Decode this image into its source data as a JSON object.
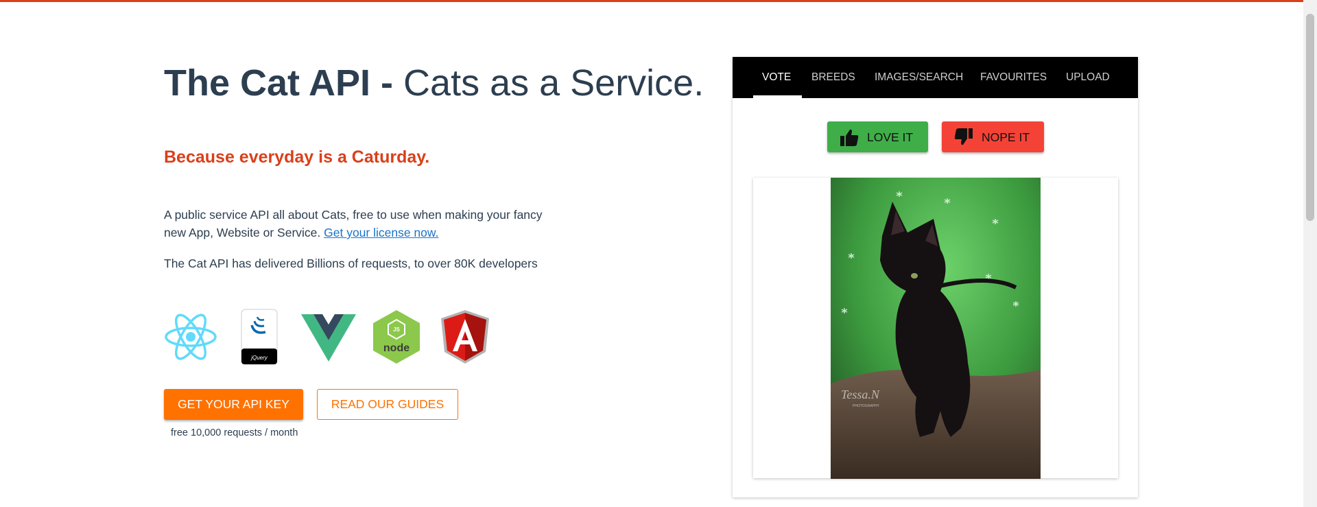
{
  "hero": {
    "title_bold": "The Cat API -",
    "title_rest": " Cats as a Service.",
    "tagline": "Because everyday is a Caturday.",
    "description": "A public service API all about Cats, free to use when making your fancy new App, Website or Service. ",
    "license_link": "Get your license now.",
    "stats": "The Cat API has delivered Billions of requests, to over 80K developers",
    "logos": [
      {
        "name": "react-logo",
        "color": "#61dafb"
      },
      {
        "name": "jquery-logo",
        "color": "#0769ad",
        "text": "jQuery"
      },
      {
        "name": "vue-logo",
        "color": "#41b883"
      },
      {
        "name": "node-logo",
        "color": "#8cc84b",
        "text": "node"
      },
      {
        "name": "angular-logo",
        "color": "#dd1b16",
        "text": "A"
      }
    ],
    "primary_button": "GET YOUR API KEY",
    "secondary_button": "READ OUR GUIDES",
    "note": "free 10,000 requests / month"
  },
  "panel": {
    "tabs": [
      "VOTE",
      "BREEDS",
      "IMAGES/SEARCH",
      "FAVOURITES",
      "UPLOAD"
    ],
    "active_tab": "VOTE",
    "love_button": "LOVE IT",
    "nope_button": "NOPE IT",
    "image_watermark": "Tessa.N",
    "image_watermark_sub": "PHOTOGRAPHY"
  },
  "colors": {
    "accent": "#d9401a",
    "orange": "#ff7200",
    "love": "#3fae49",
    "nope": "#f44336",
    "link": "#1a73c9"
  }
}
